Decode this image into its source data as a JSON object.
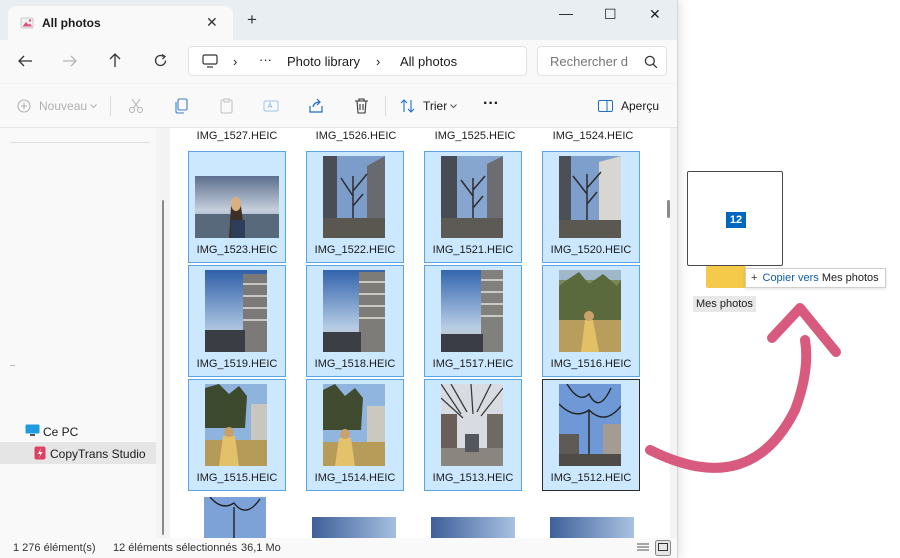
{
  "window": {
    "tab_title": "All photos",
    "tab_close": "✕",
    "new_tab": "+",
    "minimize": "—",
    "maximize": "☐",
    "close": "✕"
  },
  "address": {
    "ellipsis": "···",
    "crumbs": [
      "Photo library",
      "All photos"
    ],
    "separator": "›",
    "search_placeholder": "Rechercher d"
  },
  "toolbar": {
    "new_label": "Nouveau",
    "sort_label": "Trier",
    "more_label": "···",
    "preview_label": "Aperçu"
  },
  "sidebar": {
    "items": [
      {
        "label": "Ce PC",
        "icon": "monitor-icon",
        "selected": false
      },
      {
        "label": "CopyTrans Studio",
        "icon": "copytrans-icon",
        "selected": true
      }
    ]
  },
  "files": {
    "top_row": [
      "IMG_1527.HEIC",
      "IMG_1526.HEIC",
      "IMG_1525.HEIC",
      "IMG_1524.HEIC"
    ],
    "rows": [
      [
        "IMG_1523.HEIC",
        "IMG_1522.HEIC",
        "IMG_1521.HEIC",
        "IMG_1520.HEIC"
      ],
      [
        "IMG_1519.HEIC",
        "IMG_1518.HEIC",
        "IMG_1517.HEIC",
        "IMG_1516.HEIC"
      ],
      [
        "IMG_1515.HEIC",
        "IMG_1514.HEIC",
        "IMG_1513.HEIC",
        "IMG_1512.HEIC"
      ]
    ]
  },
  "status": {
    "count": "1 276 élément(s)",
    "selected": "12 éléments sélectionnés",
    "size": "36,1 Mo"
  },
  "drag": {
    "badge_count": "12",
    "copy_verb": "Copier vers",
    "destination": "Mes photos",
    "folder_label": "Mes photos"
  },
  "colors": {
    "selection_bg": "#cce8ff",
    "selection_border": "#5ba4e5",
    "accent": "#0067c0",
    "arrow": "#d85a7f"
  }
}
